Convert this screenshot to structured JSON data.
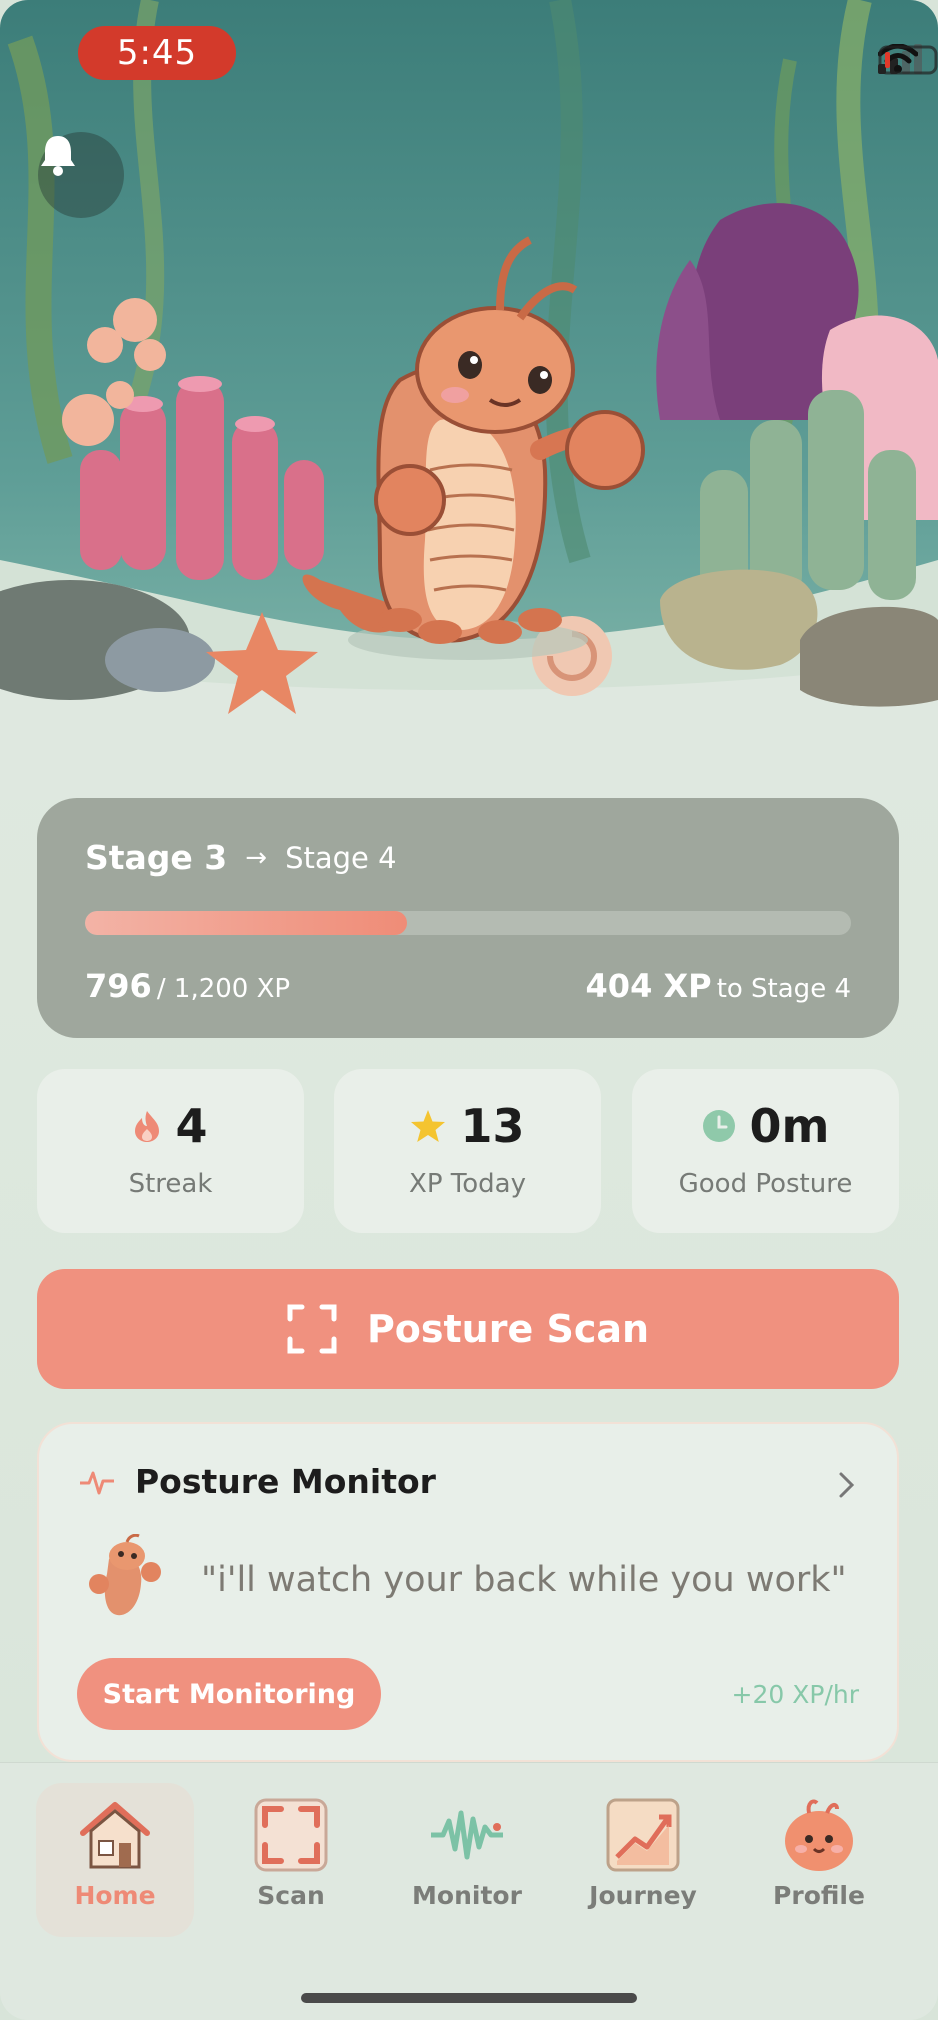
{
  "status_bar": {
    "time": "5:45"
  },
  "progress": {
    "current_stage": "Stage 3",
    "next_stage": "Stage 4",
    "xp_current": "796",
    "xp_total": "/ 1,200 XP",
    "xp_remaining": "404 XP",
    "xp_remaining_suffix": "to Stage 4",
    "fill_fraction": 0.42
  },
  "stats": [
    {
      "value": "4",
      "label": "Streak",
      "icon": "flame-icon"
    },
    {
      "value": "13",
      "label": "XP Today",
      "icon": "star-icon"
    },
    {
      "value": "0m",
      "label": "Good Posture",
      "icon": "clock-icon"
    }
  ],
  "scan_button": {
    "label": "Posture Scan",
    "icon": "scan-frame-icon"
  },
  "monitor": {
    "title": "Posture Monitor",
    "quote": "\"i'll watch your back while you work\"",
    "start_label": "Start Monitoring",
    "xp_rate": "+20 XP/hr"
  },
  "tabs": [
    {
      "label": "Home",
      "icon": "house-icon",
      "active": true
    },
    {
      "label": "Scan",
      "icon": "scan-icon",
      "active": false
    },
    {
      "label": "Monitor",
      "icon": "waveform-icon",
      "active": false
    },
    {
      "label": "Journey",
      "icon": "chart-up-icon",
      "active": false
    },
    {
      "label": "Profile",
      "icon": "shrimp-face-icon",
      "active": false
    }
  ],
  "colors": {
    "accent": "#f0917f",
    "card": "#9fa79d",
    "teal": "#87c8a9"
  }
}
